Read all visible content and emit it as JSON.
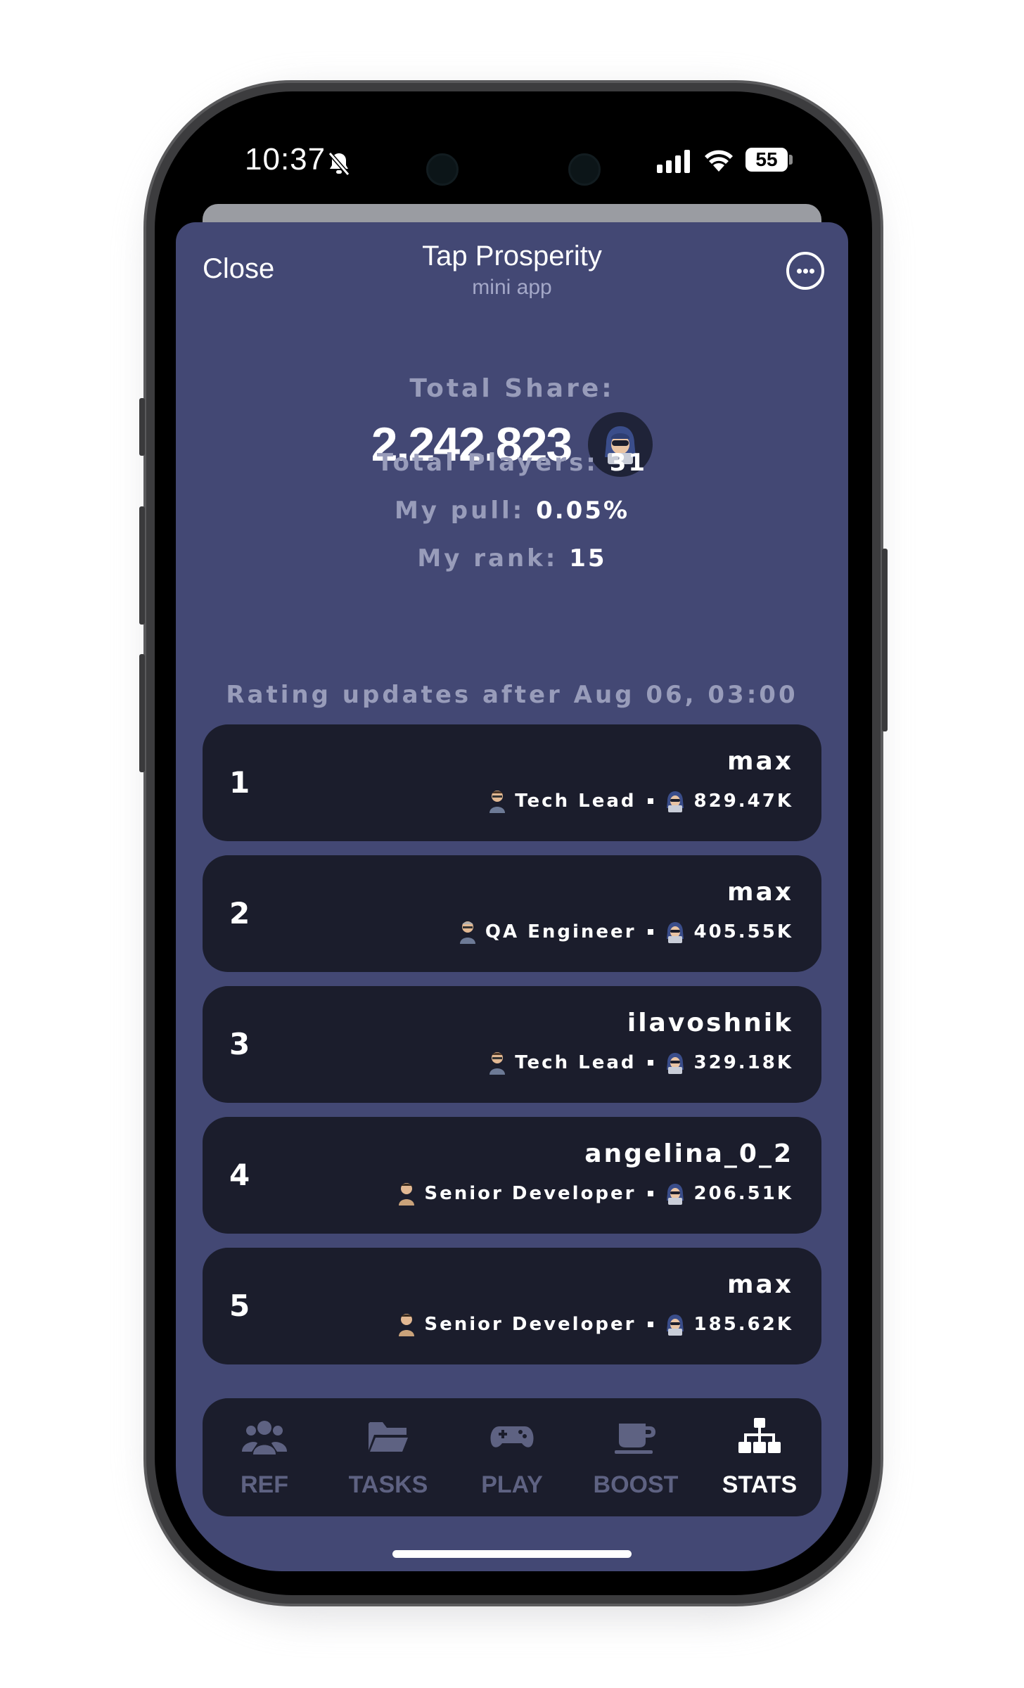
{
  "status_bar": {
    "time": "10:37",
    "battery": "55"
  },
  "header": {
    "close_label": "Close",
    "title": "Tap Prosperity",
    "subtitle": "mini app"
  },
  "stats": {
    "total_share_label": "Total Share:",
    "total_share_value": "2.242.823",
    "total_players_label": "Total Players:",
    "total_players_value": "31",
    "my_pull_label": "My pull:",
    "my_pull_value": "0.05%",
    "my_rank_label": "My rank:",
    "my_rank_value": "15"
  },
  "rating_note": "Rating updates after Aug 06, 03:00",
  "leaderboard": [
    {
      "rank": "1",
      "name": "max",
      "role": "Tech Lead",
      "score": "829.47K"
    },
    {
      "rank": "2",
      "name": "max",
      "role": "QA Engineer",
      "score": "405.55K"
    },
    {
      "rank": "3",
      "name": "ilavoshnik",
      "role": "Tech Lead",
      "score": "329.18K"
    },
    {
      "rank": "4",
      "name": "angelina_0_2",
      "role": "Senior Developer",
      "score": "206.51K"
    },
    {
      "rank": "5",
      "name": "max",
      "role": "Senior Developer",
      "score": "185.62K"
    }
  ],
  "tabs": [
    {
      "label": "REF",
      "icon": "users-icon",
      "active": false
    },
    {
      "label": "TASKS",
      "icon": "folder-icon",
      "active": false
    },
    {
      "label": "PLAY",
      "icon": "gamepad-icon",
      "active": false
    },
    {
      "label": "BOOST",
      "icon": "coffee-cup-icon",
      "active": false
    },
    {
      "label": "STATS",
      "icon": "sitemap-icon",
      "active": true
    }
  ],
  "colors": {
    "screen_bg": "#434874",
    "card_bg": "#1b1d2c",
    "muted_text": "#989cba",
    "inactive_tab": "#5e6282",
    "active_tab": "#ffffff"
  }
}
